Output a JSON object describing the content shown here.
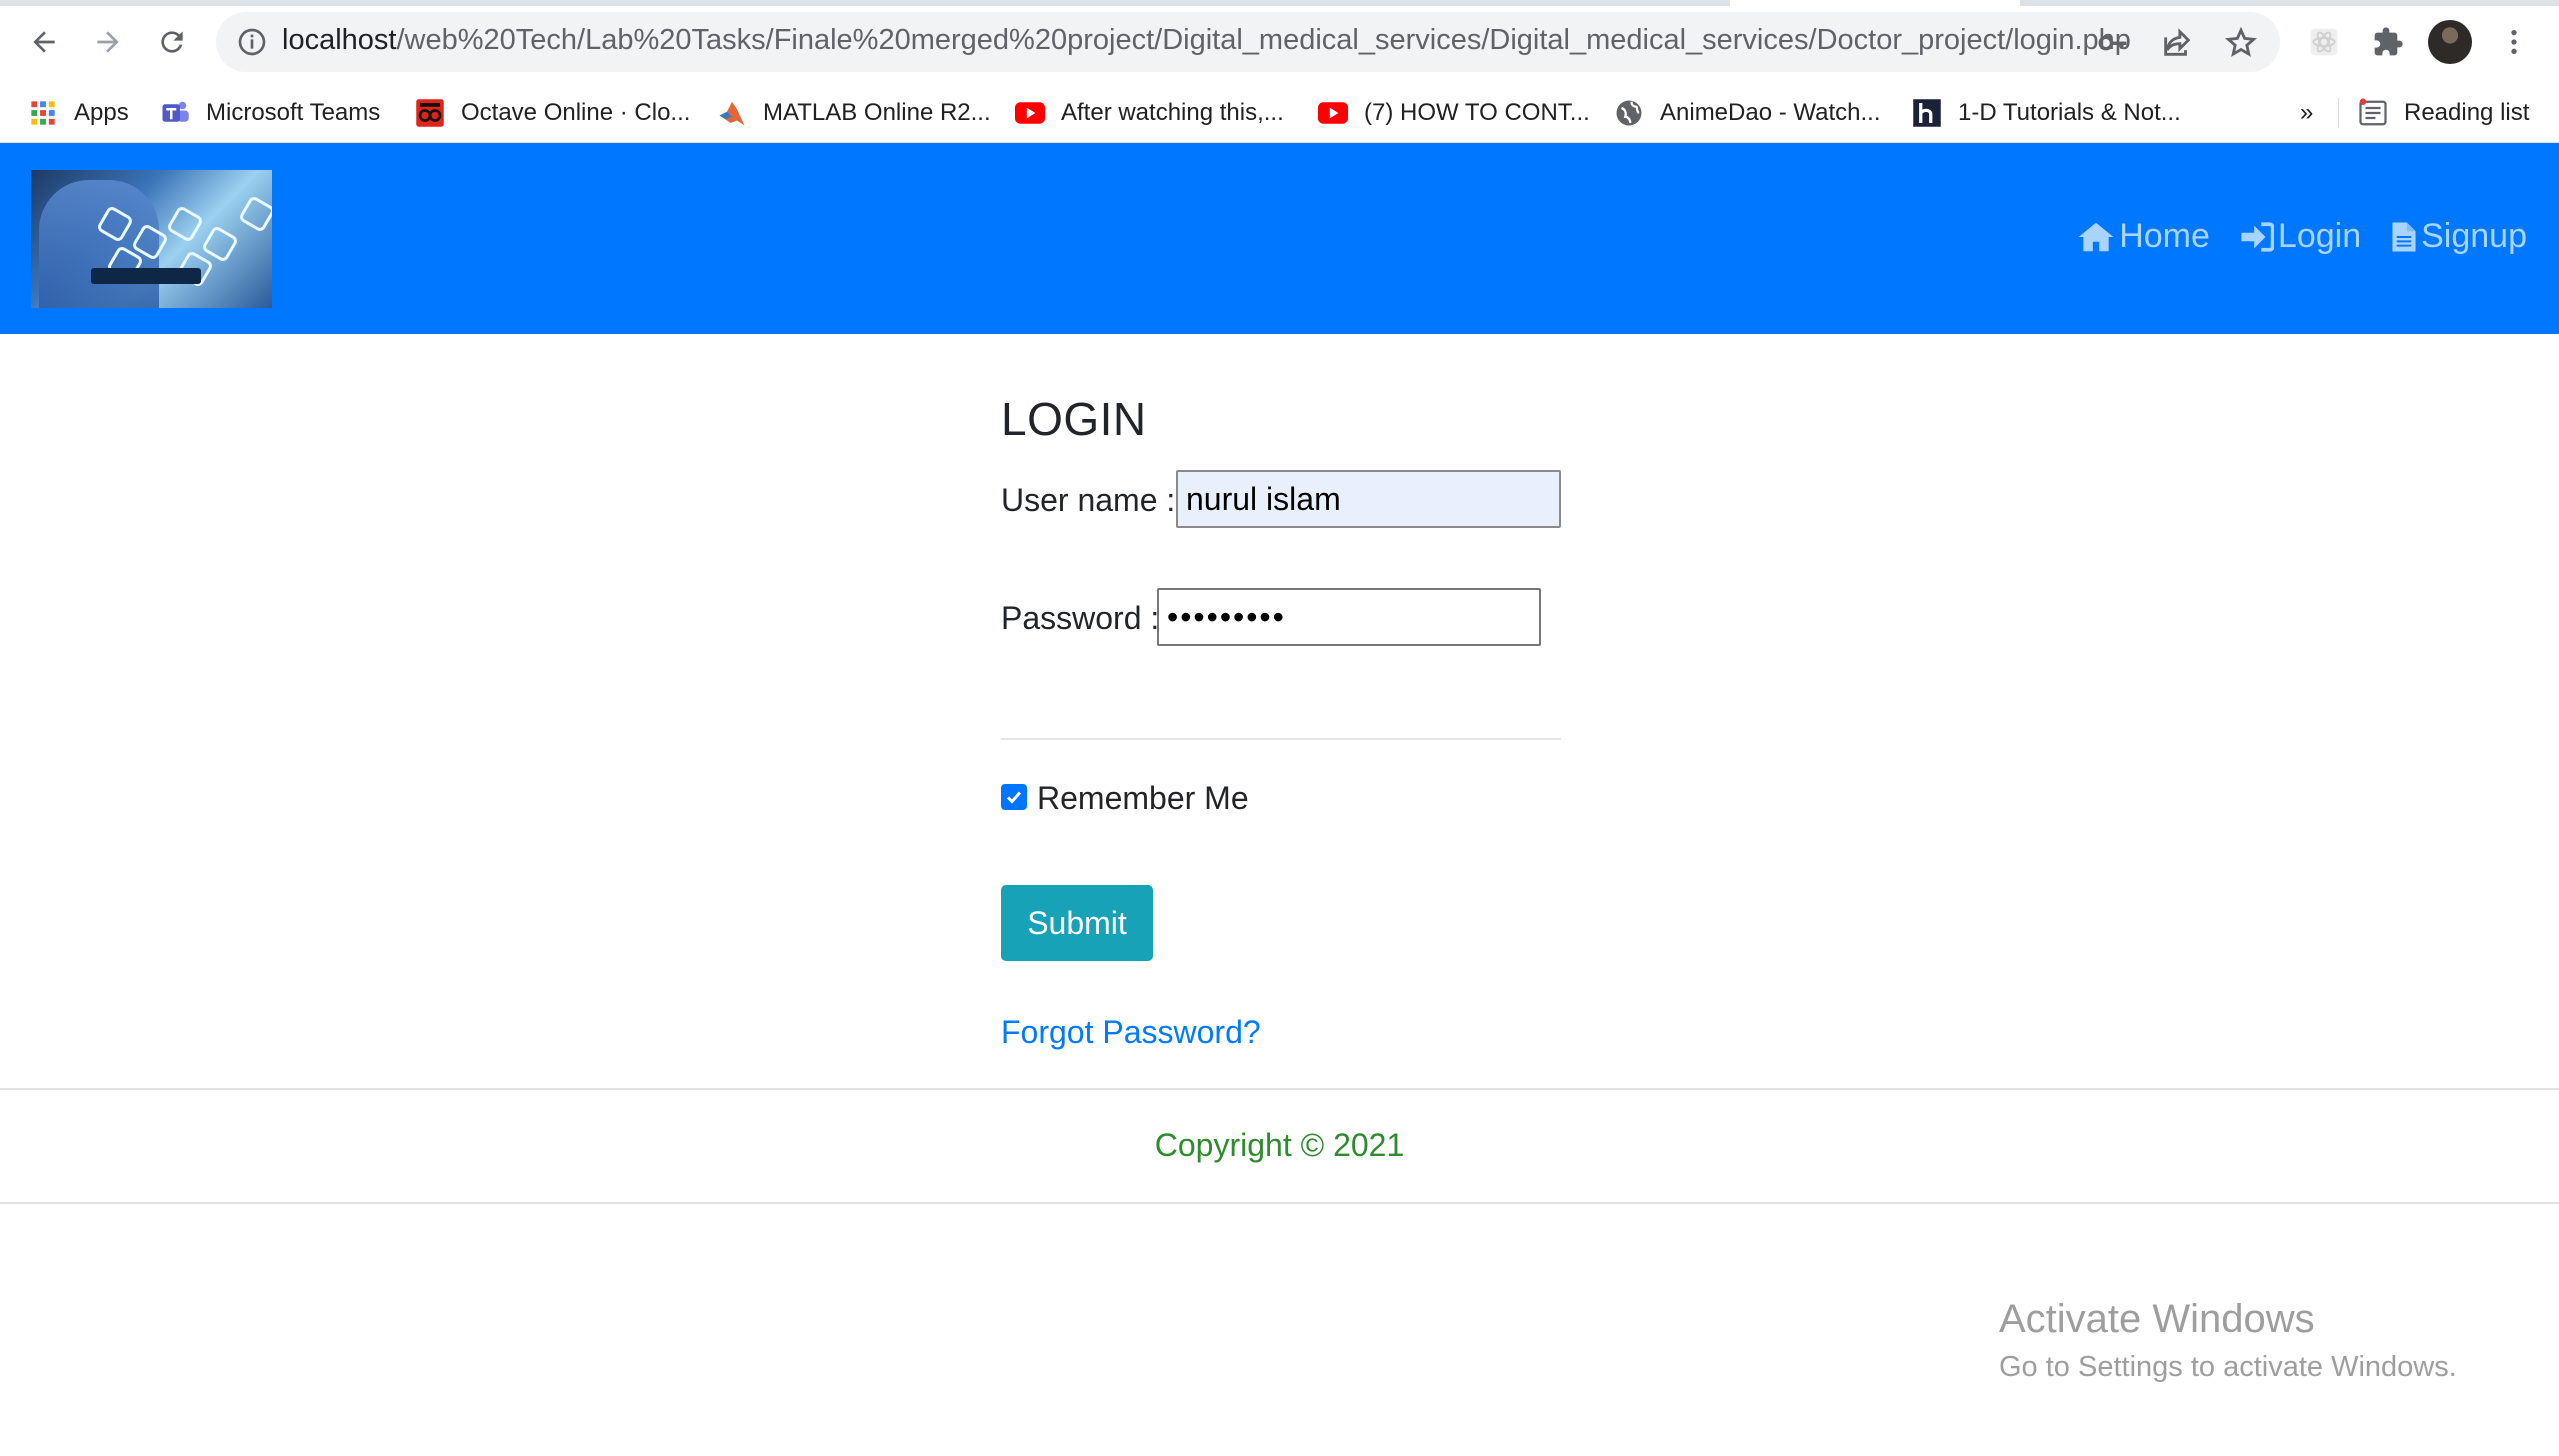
{
  "browser": {
    "url_host": "localhost",
    "url_path": "/web%20Tech/Lab%20Tasks/Finale%20merged%20project/Digital_medical_services/Digital_medical_services/Doctor_project/login.php",
    "bookmarks": [
      {
        "label": "Apps",
        "icon": "apps-grid-icon"
      },
      {
        "label": "Microsoft Teams",
        "icon": "teams-icon"
      },
      {
        "label": "Octave Online · Clo...",
        "icon": "octave-icon"
      },
      {
        "label": "MATLAB Online R2...",
        "icon": "matlab-icon"
      },
      {
        "label": "After watching this,...",
        "icon": "youtube-icon"
      },
      {
        "label": "(7) HOW TO CONT...",
        "icon": "youtube-icon"
      },
      {
        "label": "AnimeDao - Watch...",
        "icon": "globe-icon"
      },
      {
        "label": "1-D Tutorials & Not...",
        "icon": "h-site-icon"
      }
    ],
    "overflow_label": "»",
    "reading_list_label": "Reading list"
  },
  "site": {
    "nav": [
      {
        "label": "Home",
        "icon": "home-icon"
      },
      {
        "label": "Login",
        "icon": "sign-in-icon"
      },
      {
        "label": "Signup",
        "icon": "file-icon"
      }
    ]
  },
  "form": {
    "title": "LOGIN",
    "username_label": "User name :",
    "username_value": "nurul islam",
    "password_label": "Password :",
    "password_value": "•••••••••",
    "remember_label": "Remember Me",
    "remember_checked": true,
    "submit_label": "Submit",
    "forgot_label": "Forgot Password?"
  },
  "footer": {
    "copyright": "Copyright © 2021"
  },
  "watermark": {
    "title": "Activate Windows",
    "subtitle": "Go to Settings to activate Windows."
  },
  "colors": {
    "header_bg": "#0077ff",
    "nav_link": "#a8d4ff",
    "submit_bg": "#17a2b8",
    "link": "#007bff",
    "footer_text": "#2e8b2e"
  }
}
